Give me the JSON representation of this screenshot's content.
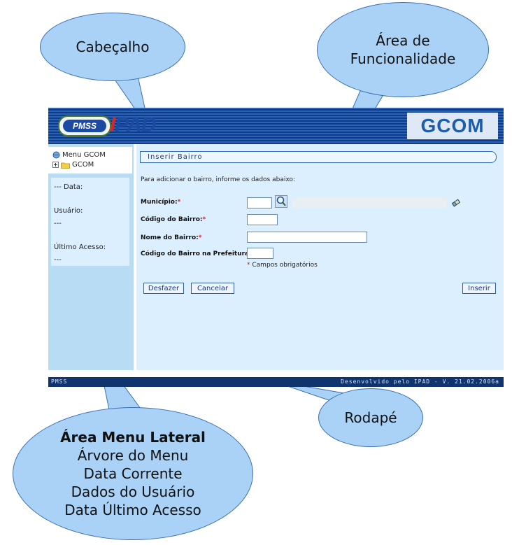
{
  "callouts": {
    "header": "Cabeçalho",
    "func_line1": "Área de",
    "func_line2": "Funcionalidade",
    "footer": "Rodapé",
    "sidebar_title": "Área Menu Lateral",
    "sidebar_items": [
      "Árvore do Menu",
      "Data Corrente",
      "Dados do Usuário",
      "Data Último Acesso"
    ]
  },
  "colors": {
    "bubble_fill": "#a9d2f6",
    "header_blue": "#0d3879",
    "sidebar_blue": "#b9dcf5",
    "main_bg": "#dbefff",
    "required_red": "#d21f1f"
  },
  "header": {
    "pmss_logo": "PMSS",
    "ipad_logo_i": "I",
    "ipad_logo_rest": "PAD",
    "gcom_logo": "GCOM"
  },
  "sidebar": {
    "tree_root": "Menu GCOM",
    "tree_child": "GCOM",
    "data_label": "--- Data:",
    "usuario_label": "Usuário:",
    "usuario_value": "---",
    "ultimo_label": "Último Acesso:",
    "ultimo_value": "---"
  },
  "main": {
    "title": "Inserir Bairro",
    "instruction": "Para adicionar o bairro, informe os dados abaixo:",
    "fields": {
      "municipio": "Município:",
      "codigo_bairro": "Código do Bairro:",
      "nome_bairro": "Nome do Bairro:",
      "codigo_prefeitura": "Código do Bairro na Prefeitura:"
    },
    "required_marker": "*",
    "required_note": "Campos obrigatórios",
    "buttons": {
      "desfazer": "Desfazer",
      "cancelar": "Cancelar",
      "inserir": "Inserir"
    },
    "icons": [
      "search-icon",
      "eraser-icon",
      "folder-icon",
      "tree-expand-icon",
      "globe-icon"
    ]
  },
  "footer": {
    "left": "PMSS",
    "right": "Desenvolvido pelo IPAD - V. 21.02.2006a"
  }
}
